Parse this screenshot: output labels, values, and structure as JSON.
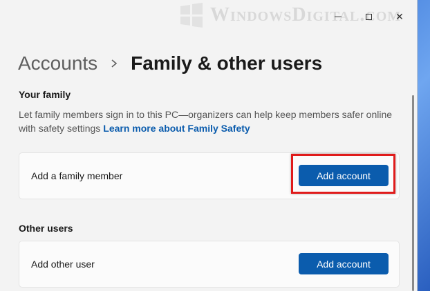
{
  "watermark": {
    "text": "WindowsDigital.com"
  },
  "titlebar": {
    "minimize_glyph": "",
    "close_glyph": "✕"
  },
  "breadcrumb": {
    "parent": "Accounts",
    "current": "Family & other users"
  },
  "your_family": {
    "title": "Your family",
    "description": "Let family members sign in to this PC—organizers can help keep members safer online with safety settings",
    "link": "Learn more about Family Safety",
    "card_label": "Add a family member",
    "button_label": "Add account"
  },
  "other_users": {
    "title": "Other users",
    "card_label": "Add other user",
    "button_label": "Add account"
  },
  "colors": {
    "accent": "#0b5cad",
    "highlight": "#e01b1b"
  }
}
